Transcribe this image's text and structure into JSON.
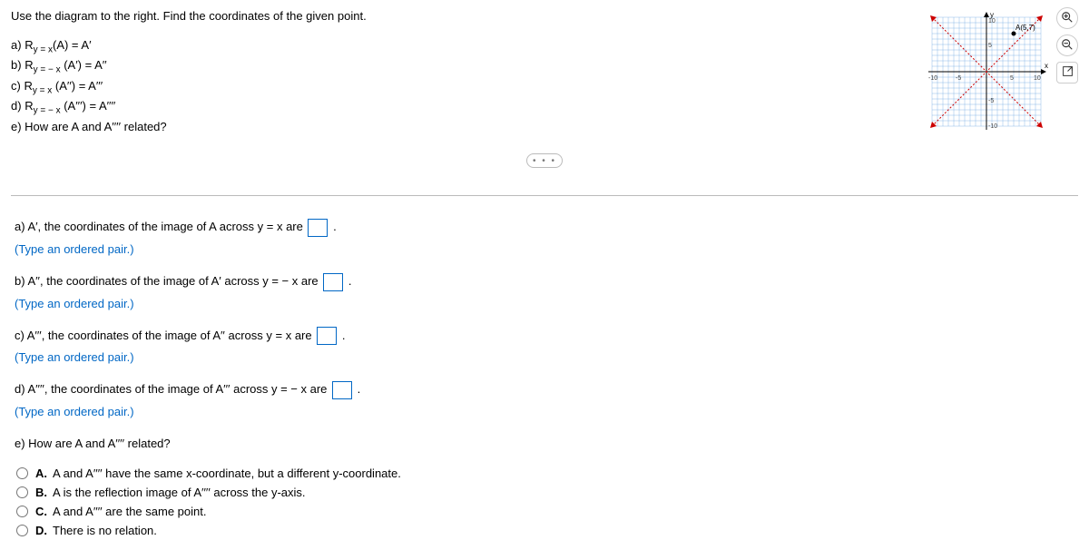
{
  "instruction": "Use the diagram to the right. Find the coordinates of the given point.",
  "items": {
    "a": {
      "label": "a)",
      "l1": "R",
      "sub": "y = x",
      "l2": "(A) = A′"
    },
    "b": {
      "label": "b)",
      "l1": "R",
      "sub": "y = − x",
      "l2": " (A′) = A′′"
    },
    "c": {
      "label": "c)",
      "l1": "R",
      "sub": "y = x",
      "l2": " (A′′) = A′′′"
    },
    "d": {
      "label": "d)",
      "l1": "R",
      "sub": "y = − x",
      "l2": " (A′′′) = A′′′′"
    },
    "e": {
      "label": "e) How are A and A′′′′ related?"
    }
  },
  "ans": {
    "a": {
      "pre": "a) A′, the coordinates of the image of A across y = x are ",
      "post": "."
    },
    "b": {
      "pre": "b) A′′, the coordinates of the image of A′ across y = − x are ",
      "post": "."
    },
    "c": {
      "pre": "c) A′′′, the coordinates of the image of A′′ across y = x are ",
      "post": "."
    },
    "d": {
      "pre": "d) A′′′′, the coordinates of the image of A′′′ across y = − x are ",
      "post": "."
    },
    "hint": "(Type an ordered pair.)",
    "e": "e) How are A and A′′′′ related?"
  },
  "choices": {
    "A": {
      "letter": "A.",
      "text": "A and A′′′′ have the same x-coordinate, but a different y-coordinate."
    },
    "B": {
      "letter": "B.",
      "text": "A is the reflection image of A′′′′ across the y-axis."
    },
    "C": {
      "letter": "C.",
      "text": "A and A′′′′ are the same point."
    },
    "D": {
      "letter": "D.",
      "text": "There is no relation."
    }
  },
  "graph": {
    "point_label": "A(5,7)",
    "ylabel": "y",
    "xlabel": "x",
    "ticks": [
      "-10",
      "-5",
      "5",
      "10",
      "-5",
      "-10",
      "5",
      "10"
    ]
  },
  "icons": {
    "zoom_in": "⊕",
    "zoom_out": "⊖",
    "expand": "⛶",
    "dots": "• • •"
  },
  "chart_data": {
    "type": "scatter",
    "title": "",
    "xlabel": "x",
    "ylabel": "y",
    "xlim": [
      -10,
      10
    ],
    "ylim": [
      -10,
      10
    ],
    "grid": true,
    "series": [
      {
        "name": "A",
        "x": [
          5
        ],
        "y": [
          7
        ]
      }
    ],
    "reference_lines": [
      {
        "name": "y = x",
        "type": "line",
        "points": [
          [
            -10,
            -10
          ],
          [
            10,
            10
          ]
        ]
      },
      {
        "name": "y = -x",
        "type": "line",
        "points": [
          [
            -10,
            10
          ],
          [
            10,
            -10
          ]
        ]
      }
    ],
    "tick_labels_x": [
      -10,
      -5,
      5,
      10
    ],
    "tick_labels_y": [
      -10,
      -5,
      5,
      10
    ],
    "annotations": [
      {
        "text": "A(5,7)",
        "x": 5,
        "y": 7
      }
    ]
  }
}
